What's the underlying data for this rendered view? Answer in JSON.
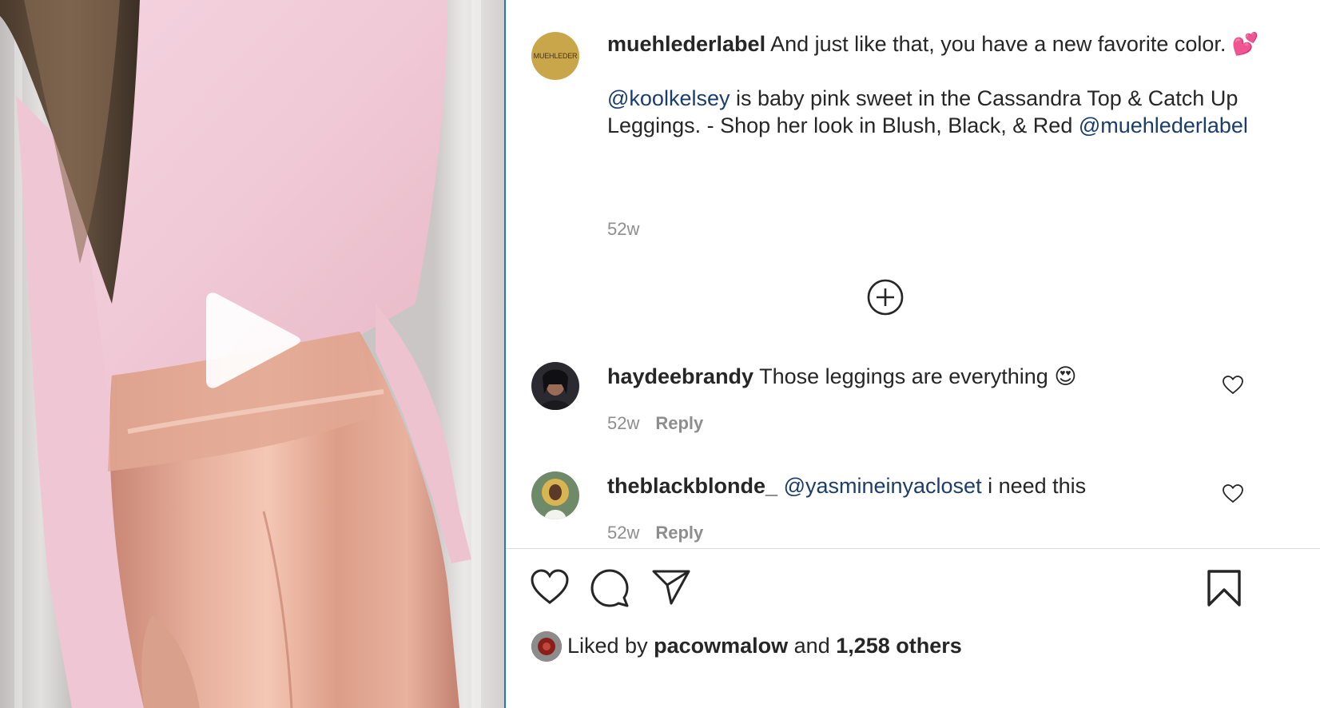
{
  "media": {
    "type": "video",
    "play_icon": "play-icon"
  },
  "post": {
    "author": "muehlederlabel",
    "author_avatar_text": "MUEHLEDER",
    "caption_text": "And just like that, you have a new favorite color. 💕",
    "mention_1": "@koolkelsey",
    "caption_body": "is baby pink sweet in the Cassandra Top & Catch Up Leggings. - Shop her look in Blush, Black, & Red",
    "mention_2": "@muehlederlabel",
    "time": "52w"
  },
  "load_more_icon": "plus-circle-icon",
  "comments": [
    {
      "username": "haydeebrandy",
      "text": "Those leggings are everything 😍",
      "time": "52w",
      "reply_label": "Reply"
    },
    {
      "username": "theblackblonde_",
      "mention": "@yasmineinyacloset",
      "text": "i need this",
      "time": "52w",
      "reply_label": "Reply"
    }
  ],
  "actions": {
    "like_icon": "heart-icon",
    "comment_icon": "comment-icon",
    "share_icon": "share-icon",
    "save_icon": "bookmark-icon"
  },
  "likes": {
    "prefix": "Liked by",
    "user": "pacowmalow",
    "joiner": "and",
    "others": "1,258 others"
  },
  "colors": {
    "accent_link": "#1b3d6e",
    "muted": "#8e8e8e",
    "divider": "#2f6fd1"
  }
}
